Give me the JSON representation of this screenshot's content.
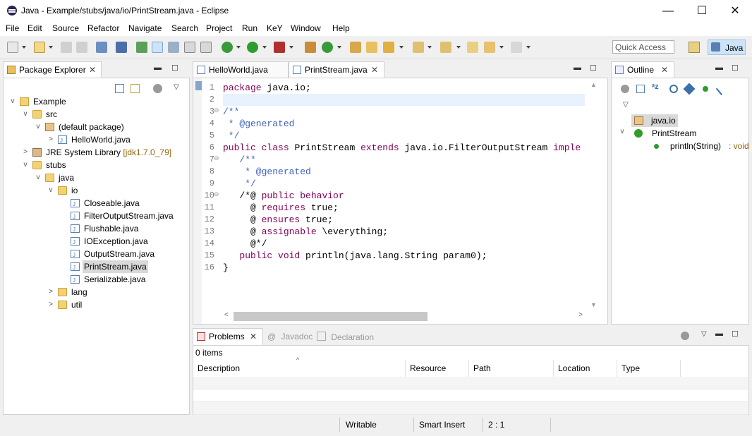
{
  "window": {
    "title": "Java - Example/stubs/java/io/PrintStream.java - Eclipse",
    "controls": {
      "minimize": "—",
      "maximize": "☐",
      "close": "✕"
    }
  },
  "menu": [
    "File",
    "Edit",
    "Source",
    "Refactor",
    "Navigate",
    "Search",
    "Project",
    "Run",
    "KeY",
    "Window",
    "Help"
  ],
  "toolbar": {
    "quick_access": "Quick Access",
    "perspective": "Java"
  },
  "package_explorer": {
    "title": "Package Explorer",
    "tree": [
      {
        "label": "Example",
        "type": "project",
        "level": 0,
        "twisty": "open"
      },
      {
        "label": "src",
        "type": "srcfolder",
        "level": 1,
        "twisty": "open"
      },
      {
        "label": "(default package)",
        "type": "package",
        "level": 2,
        "twisty": "open"
      },
      {
        "label": "HelloWorld.java",
        "type": "file",
        "level": 3,
        "twisty": "closed"
      },
      {
        "label": "JRE System Library",
        "suffix": "[jdk1.7.0_79]",
        "type": "library",
        "level": 1,
        "twisty": "closed"
      },
      {
        "label": "stubs",
        "type": "folder",
        "level": 1,
        "twisty": "open"
      },
      {
        "label": "java",
        "type": "folder",
        "level": 2,
        "twisty": "open"
      },
      {
        "label": "io",
        "type": "folder",
        "level": 3,
        "twisty": "open"
      },
      {
        "label": "Closeable.java",
        "type": "file",
        "level": 4,
        "twisty": "none"
      },
      {
        "label": "FilterOutputStream.java",
        "type": "file",
        "level": 4,
        "twisty": "none"
      },
      {
        "label": "Flushable.java",
        "type": "file",
        "level": 4,
        "twisty": "none"
      },
      {
        "label": "IOException.java",
        "type": "file",
        "level": 4,
        "twisty": "none"
      },
      {
        "label": "OutputStream.java",
        "type": "file",
        "level": 4,
        "twisty": "none"
      },
      {
        "label": "PrintStream.java",
        "type": "file",
        "level": 4,
        "twisty": "none",
        "selected": true
      },
      {
        "label": "Serializable.java",
        "type": "file",
        "level": 4,
        "twisty": "none"
      },
      {
        "label": "lang",
        "type": "folder",
        "level": 3,
        "twisty": "closed"
      },
      {
        "label": "util",
        "type": "folder",
        "level": 3,
        "twisty": "closed"
      }
    ]
  },
  "editor": {
    "tabs": [
      {
        "label": "HelloWorld.java",
        "active": false
      },
      {
        "label": "PrintStream.java",
        "active": true
      }
    ],
    "lines": [
      {
        "n": "1",
        "segs": [
          [
            "kw",
            "package"
          ],
          [
            "t",
            " java.io;"
          ]
        ]
      },
      {
        "n": "2",
        "segs": [],
        "current": true
      },
      {
        "n": "3",
        "fold": true,
        "segs": [
          [
            "cm",
            "/**"
          ]
        ]
      },
      {
        "n": "4",
        "segs": [
          [
            "cm",
            " * @generated"
          ]
        ]
      },
      {
        "n": "5",
        "segs": [
          [
            "cm",
            " */"
          ]
        ]
      },
      {
        "n": "6",
        "segs": [
          [
            "kw",
            "public"
          ],
          [
            "t",
            " "
          ],
          [
            "kw",
            "class"
          ],
          [
            "t",
            " PrintStream "
          ],
          [
            "kw",
            "extends"
          ],
          [
            "t",
            " java.io.FilterOutputStream "
          ],
          [
            "kw",
            "imple"
          ]
        ]
      },
      {
        "n": "7",
        "fold": true,
        "segs": [
          [
            "cm",
            "   /**"
          ]
        ]
      },
      {
        "n": "8",
        "segs": [
          [
            "cm",
            "    * @generated"
          ]
        ]
      },
      {
        "n": "9",
        "segs": [
          [
            "cm",
            "    */"
          ]
        ]
      },
      {
        "n": "10",
        "fold": true,
        "segs": [
          [
            "t",
            "   /*@ "
          ],
          [
            "jml",
            "public"
          ],
          [
            "t",
            " "
          ],
          [
            "jml",
            "behavior"
          ]
        ]
      },
      {
        "n": "11",
        "segs": [
          [
            "t",
            "     @ "
          ],
          [
            "jml",
            "requires"
          ],
          [
            "t",
            " true;"
          ]
        ]
      },
      {
        "n": "12",
        "segs": [
          [
            "t",
            "     @ "
          ],
          [
            "jml",
            "ensures"
          ],
          [
            "t",
            " true;"
          ]
        ]
      },
      {
        "n": "13",
        "segs": [
          [
            "t",
            "     @ "
          ],
          [
            "jml",
            "assignable"
          ],
          [
            "t",
            " \\everything;"
          ]
        ]
      },
      {
        "n": "14",
        "segs": [
          [
            "t",
            "     @*/"
          ]
        ]
      },
      {
        "n": "15",
        "segs": [
          [
            "t",
            "   "
          ],
          [
            "kw",
            "public"
          ],
          [
            "t",
            " "
          ],
          [
            "kw",
            "void"
          ],
          [
            "t",
            " println(java.lang.String param0);"
          ]
        ]
      },
      {
        "n": "16",
        "segs": [
          [
            "t",
            "}"
          ]
        ]
      }
    ]
  },
  "outline": {
    "title": "Outline",
    "items": [
      {
        "label": "java.io",
        "type": "package"
      },
      {
        "label": "PrintStream",
        "type": "class"
      },
      {
        "label": "println(String)",
        "suffix": " : void",
        "type": "method"
      }
    ]
  },
  "bottom": {
    "tabs": [
      "Problems",
      "Javadoc",
      "Declaration"
    ],
    "count": "0 items",
    "columns": [
      "Description",
      "Resource",
      "Path",
      "Location",
      "Type"
    ]
  },
  "status": {
    "writable": "Writable",
    "insert": "Smart Insert",
    "position": "2 : 1"
  },
  "colors": {
    "keyword": "#7f0055",
    "comment": "#3f5fbf",
    "selection": "#cde3f7"
  }
}
